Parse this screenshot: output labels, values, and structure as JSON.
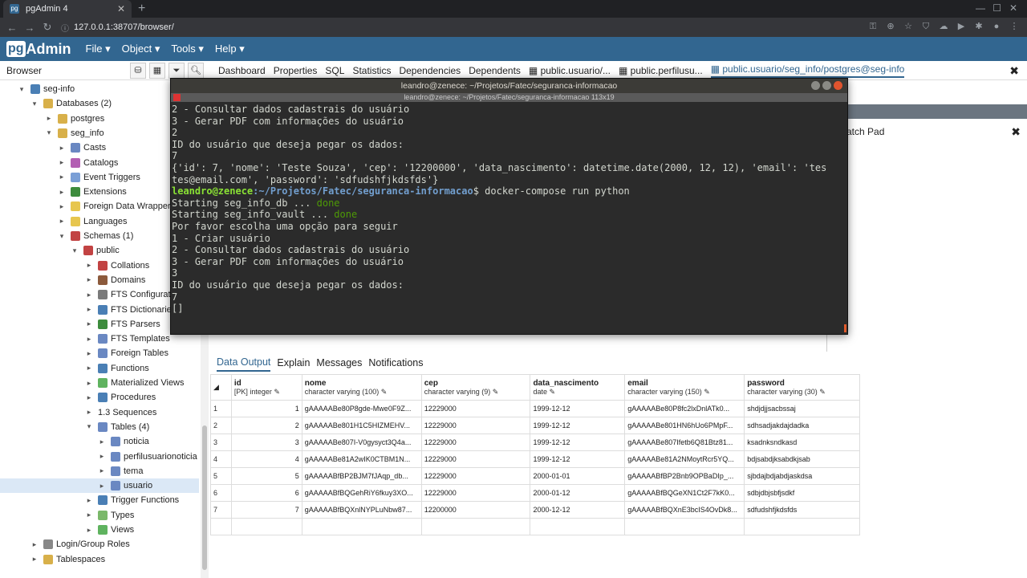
{
  "browser_chrome": {
    "tab_title": "pgAdmin 4",
    "url": "127.0.0.1:38707/browser/"
  },
  "app": {
    "logo": "Admin",
    "menus": [
      "File ▾",
      "Object ▾",
      "Tools ▾",
      "Help ▾"
    ]
  },
  "browser_panel": {
    "title": "Browser",
    "tree": [
      {
        "label": "seg-info",
        "level": 1,
        "arrow": "▾",
        "icon_color": "#4a7fb5"
      },
      {
        "label": "Databases (2)",
        "level": 2,
        "arrow": "▾",
        "icon_color": "#d8b04a"
      },
      {
        "label": "postgres",
        "level": 3,
        "arrow": "▸",
        "icon_color": "#d8b04a"
      },
      {
        "label": "seg_info",
        "level": 3,
        "arrow": "▾",
        "icon_color": "#d8b04a"
      },
      {
        "label": "Casts",
        "level": 4,
        "arrow": "▸",
        "icon_color": "#6a88c2"
      },
      {
        "label": "Catalogs",
        "level": 4,
        "arrow": "▸",
        "icon_color": "#b35fb3"
      },
      {
        "label": "Event Triggers",
        "level": 4,
        "arrow": "▸",
        "icon_color": "#7a9fd6"
      },
      {
        "label": "Extensions",
        "level": 4,
        "arrow": "▸",
        "icon_color": "#3d8c3d"
      },
      {
        "label": "Foreign Data Wrappers",
        "level": 4,
        "arrow": "▸",
        "icon_color": "#e7c64e"
      },
      {
        "label": "Languages",
        "level": 4,
        "arrow": "▸",
        "icon_color": "#e7c64e"
      },
      {
        "label": "Schemas (1)",
        "level": 4,
        "arrow": "▾",
        "icon_color": "#c24343"
      },
      {
        "label": "public",
        "level": 5,
        "arrow": "▾",
        "icon_color": "#c24343"
      },
      {
        "label": "Collations",
        "level": 6,
        "arrow": "▸",
        "icon_color": "#c24343"
      },
      {
        "label": "Domains",
        "level": 6,
        "arrow": "▸",
        "icon_color": "#8c5a3c"
      },
      {
        "label": "FTS Configurations",
        "level": 6,
        "arrow": "▸",
        "icon_color": "#7a7a7a"
      },
      {
        "label": "FTS Dictionaries",
        "level": 6,
        "arrow": "▸",
        "icon_color": "#4a7fb5"
      },
      {
        "label": "FTS Parsers",
        "level": 6,
        "arrow": "▸",
        "icon_color": "#3d8c3d"
      },
      {
        "label": "FTS Templates",
        "level": 6,
        "arrow": "▸",
        "icon_color": "#6a88c2"
      },
      {
        "label": "Foreign Tables",
        "level": 6,
        "arrow": "▸",
        "icon_color": "#6a88c2"
      },
      {
        "label": "Functions",
        "level": 6,
        "arrow": "▸",
        "icon_color": "#4a7fb5"
      },
      {
        "label": "Materialized Views",
        "level": 6,
        "arrow": "▸",
        "icon_color": "#5fb35f"
      },
      {
        "label": "Procedures",
        "level": 6,
        "arrow": "▸",
        "icon_color": "#4a7fb5"
      },
      {
        "label": "1.3 Sequences",
        "level": 6,
        "arrow": "▸",
        "icon_color": ""
      },
      {
        "label": "Tables (4)",
        "level": 6,
        "arrow": "▾",
        "icon_color": "#6a88c2"
      },
      {
        "label": "noticia",
        "level": 7,
        "arrow": "▸",
        "icon_color": "#6a88c2"
      },
      {
        "label": "perfilusuarionoticia",
        "level": 7,
        "arrow": "▸",
        "icon_color": "#6a88c2"
      },
      {
        "label": "tema",
        "level": 7,
        "arrow": "▸",
        "icon_color": "#6a88c2"
      },
      {
        "label": "usuario",
        "level": 7,
        "arrow": "▸",
        "icon_color": "#6a88c2",
        "selected": true
      },
      {
        "label": "Trigger Functions",
        "level": 6,
        "arrow": "▸",
        "icon_color": "#4a7fb5"
      },
      {
        "label": "Types",
        "level": 6,
        "arrow": "▸",
        "icon_color": "#7ab86a"
      },
      {
        "label": "Views",
        "level": 6,
        "arrow": "▸",
        "icon_color": "#5fb35f"
      },
      {
        "label": "Login/Group Roles",
        "level": 2,
        "arrow": "▸",
        "icon_color": "#888"
      },
      {
        "label": "Tablespaces",
        "level": 2,
        "arrow": "▸",
        "icon_color": "#d8b04a"
      }
    ]
  },
  "main_tabs": [
    "Dashboard",
    "Properties",
    "SQL",
    "Statistics",
    "Dependencies",
    "Dependents",
    "public.usuario/...",
    "public.perfilusu...",
    "public.usuario/seg_info/postgres@seg-info"
  ],
  "scratch_pad": "Scratch Pad",
  "result_tabs": [
    "Data Output",
    "Explain",
    "Messages",
    "Notifications"
  ],
  "grid": {
    "columns": [
      {
        "name": "id",
        "type": "[PK] integer"
      },
      {
        "name": "nome",
        "type": "character varying (100)"
      },
      {
        "name": "cep",
        "type": "character varying (9)"
      },
      {
        "name": "data_nascimento",
        "type": "date"
      },
      {
        "name": "email",
        "type": "character varying (150)"
      },
      {
        "name": "password",
        "type": "character varying (30)"
      }
    ],
    "rows": [
      [
        "1",
        "1",
        "gAAAAABe80P8gde-Mwe0F9Z...",
        "12229000",
        "1999-12-12",
        "gAAAAABe80P8fc2lxDnlATk0...",
        "shdjdjjsacbssaj"
      ],
      [
        "2",
        "2",
        "gAAAAABe801H1C5HIZMEHV...",
        "12229000",
        "1999-12-12",
        "gAAAAABe801HN6hUo6PMpF...",
        "sdhsadjakdajdadka"
      ],
      [
        "3",
        "3",
        "gAAAAABe807I-V0gysyct3Q4a...",
        "12229000",
        "1999-12-12",
        "gAAAAABe807Ifetb6Q81Btz81...",
        "ksadnksndkasd"
      ],
      [
        "4",
        "4",
        "gAAAAABe81A2wIK0CTBM1N...",
        "12229000",
        "1999-12-12",
        "gAAAAABe81A2NMoytRcr5YQ...",
        "bdjsabdjksabdkjsab"
      ],
      [
        "5",
        "5",
        "gAAAAABfBP2BJM7fJAqp_db...",
        "12229000",
        "2000-01-01",
        "gAAAAABfBP2Bnb9OPBaDIp_...",
        "sjbdajbdjabdjaskdsa"
      ],
      [
        "6",
        "6",
        "gAAAAABfBQGehRiY6fkuy3XO...",
        "12229000",
        "2000-01-12",
        "gAAAAABfBQGeXN1Ct2F7kK0...",
        "sdbjdbjsbfjsdkf"
      ],
      [
        "7",
        "7",
        "gAAAAABfBQXnlNYPLuNbw87...",
        "12200000",
        "2000-12-12",
        "gAAAAABfBQXnE3bcIS4OvDk8...",
        "sdfudshfjkdsfds"
      ]
    ]
  },
  "terminal": {
    "title": "leandro@zenece: ~/Projetos/Fatec/seguranca-informacao",
    "subtitle": "leandro@zenece: ~/Projetos/Fatec/seguranca-informacao 113x19",
    "lines": [
      {
        "t": "2 - Consultar dados cadastrais do usuário"
      },
      {
        "t": "3 - Gerar PDF com informações do usuário"
      },
      {
        "t": "2"
      },
      {
        "t": "ID do usuário que deseja pegar os dados:"
      },
      {
        "t": "7"
      },
      {
        "t": "{'id': 7, 'nome': 'Teste Souza', 'cep': '12200000', 'data_nascimento': datetime.date(2000, 12, 12), 'email': 'tes"
      },
      {
        "t": "tes@email.com', 'password': 'sdfudshfjkdsfds'}"
      },
      {
        "prompt_user": "leandro@zenece",
        "prompt_path": ":~/Projetos/Fatec/seguranca-informacao",
        "t": "$ docker-compose run python"
      },
      {
        "t": "Starting seg_info_db ... ",
        "done": "done"
      },
      {
        "t": "Starting seg_info_vault ... ",
        "done": "done"
      },
      {
        "t": "Por favor escolha uma opção para seguir"
      },
      {
        "t": "1 - Criar usuário"
      },
      {
        "t": "2 - Consultar dados cadastrais do usuário"
      },
      {
        "t": "3 - Gerar PDF com informações do usuário"
      },
      {
        "t": "3"
      },
      {
        "t": "ID do usuário que deseja pegar os dados:"
      },
      {
        "t": "7"
      },
      {
        "t": "[]"
      }
    ]
  }
}
